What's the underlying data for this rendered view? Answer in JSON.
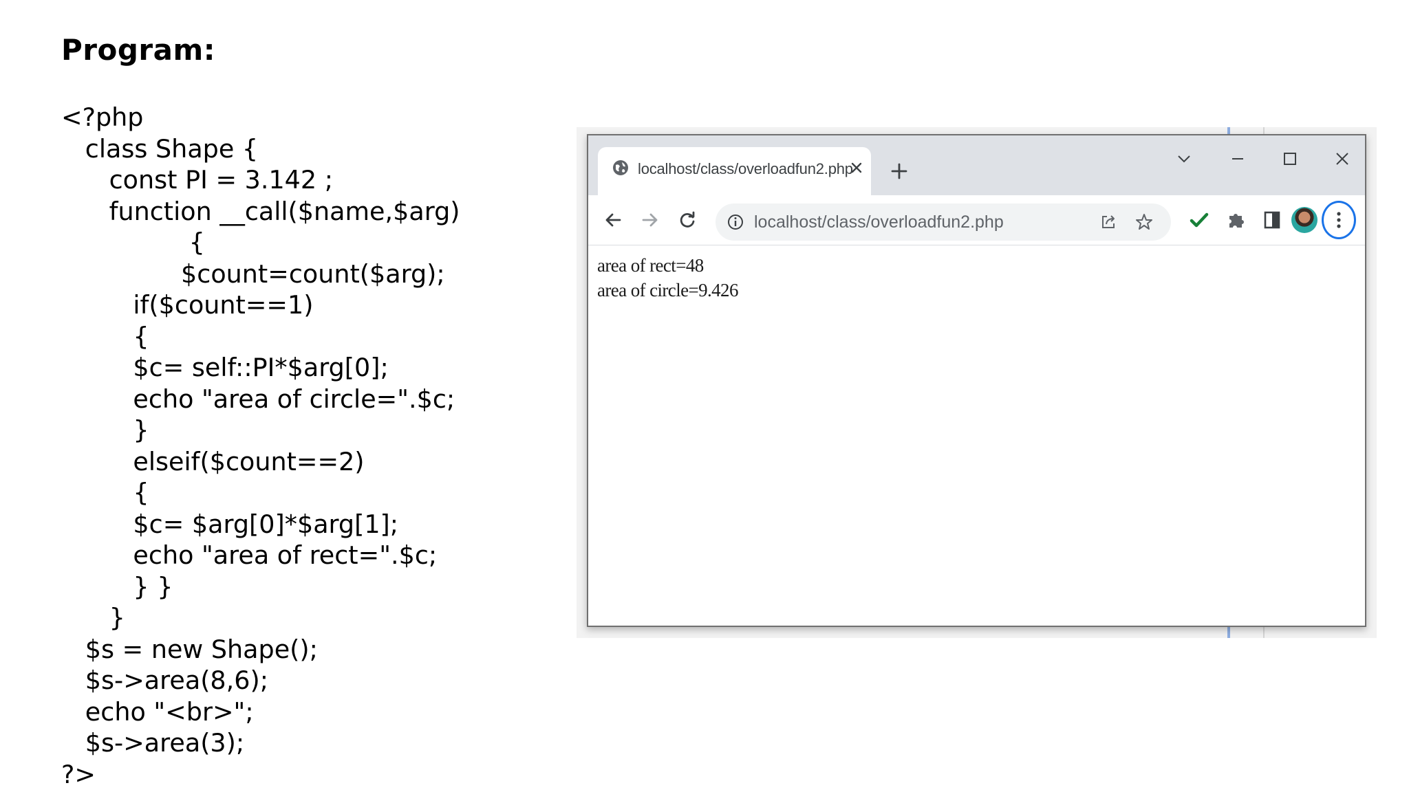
{
  "slide": {
    "title": "Program:",
    "code_lines": [
      "<?php",
      "   class Shape {",
      "      const PI = 3.142 ;",
      "      function __call($name,$arg)",
      "                {",
      "               $count=count($arg);",
      "         if($count==1)",
      "         {",
      "         $c= self::PI*$arg[0];",
      "         echo \"area of circle=\".$c;",
      "         }",
      "         elseif($count==2)",
      "         {",
      "         $c= $arg[0]*$arg[1];",
      "         echo \"area of rect=\".$c;",
      "         } }",
      "      }",
      "   $s = new Shape();",
      "   $s->area(8,6);",
      "   echo \"<br>\";",
      "   $s->area(3);",
      "?>"
    ]
  },
  "browser": {
    "tab_title": "localhost/class/overloadfun2.php",
    "url": "localhost/class/overloadfun2.php",
    "output_lines": [
      "area of rect=48",
      "area of circle=9.426"
    ],
    "icons": {
      "favicon": "globe-icon",
      "tab_close": "close-icon",
      "new_tab": "plus-icon",
      "tab_search": "chevron-down-icon",
      "minimize": "minimize-icon",
      "maximize": "maximize-icon",
      "close": "close-icon",
      "back": "back-arrow-icon",
      "forward": "forward-arrow-icon",
      "reload": "reload-icon",
      "site_info": "info-icon",
      "share": "share-icon",
      "bookmark": "star-icon",
      "extension_check": "checkmark-icon",
      "extensions": "puzzle-icon",
      "side_panel": "side-panel-icon",
      "profile": "avatar",
      "menu": "kebab-menu-icon"
    },
    "colors": {
      "tabstrip": "#dee1e6",
      "omnibox": "#f1f3f4",
      "accent": "#1a73e8",
      "check": "#188038"
    }
  }
}
